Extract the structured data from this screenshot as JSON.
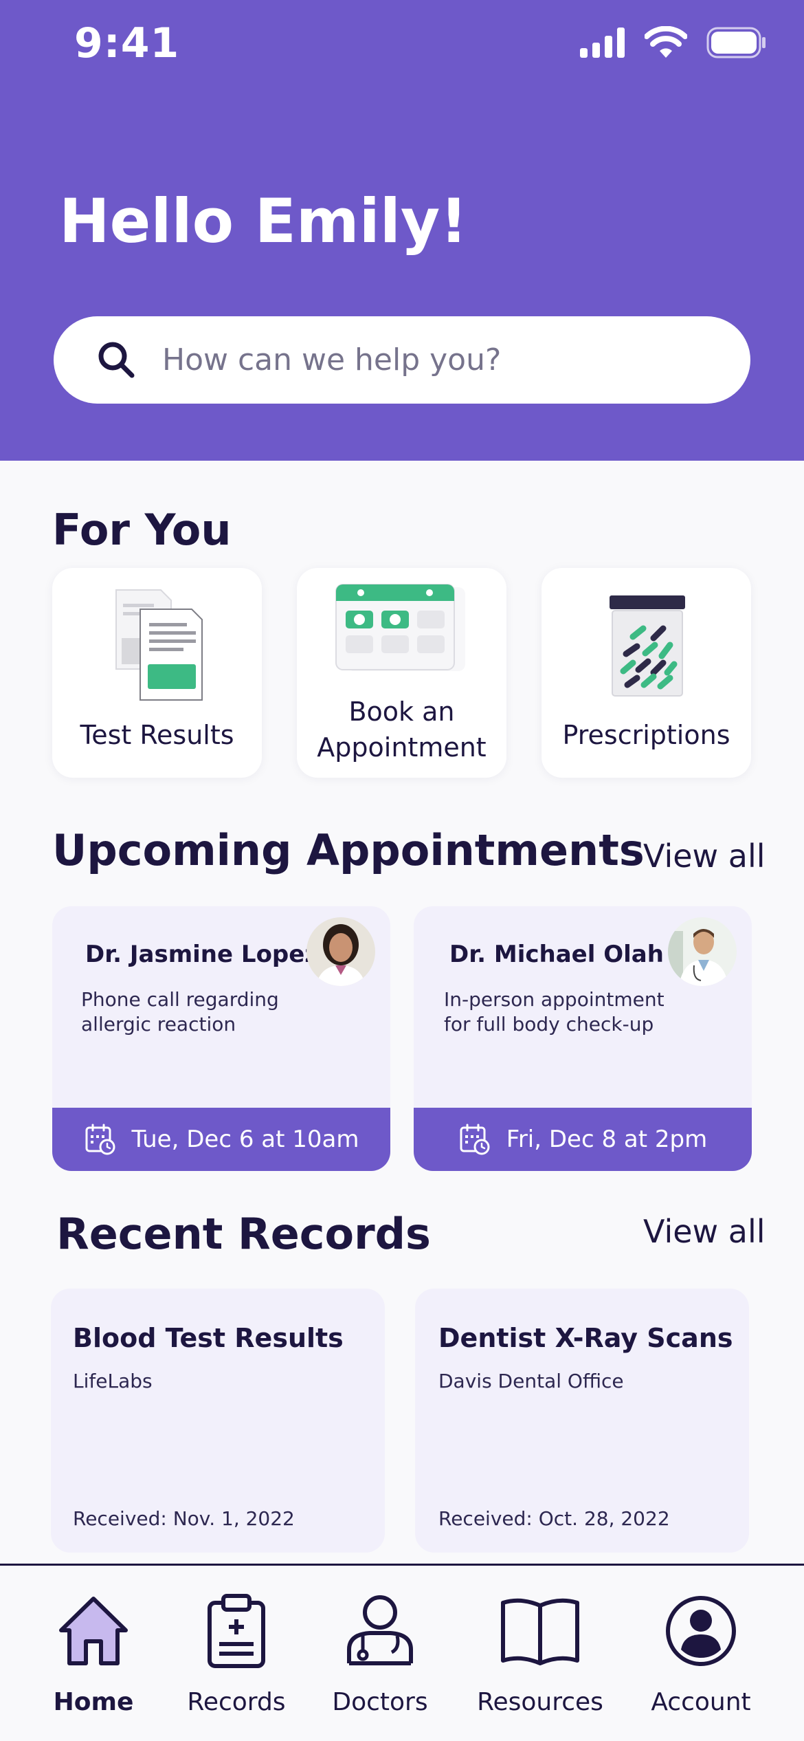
{
  "status_bar": {
    "time": "9:41"
  },
  "header": {
    "greeting": "Hello Emily!",
    "search_placeholder": "How can we help you?"
  },
  "for_you": {
    "title": "For You",
    "cards": [
      {
        "label": "Test Results",
        "icon": "documents-icon"
      },
      {
        "label": "Book an Appointment",
        "icon": "calendar-icon"
      },
      {
        "label": "Prescriptions",
        "icon": "pill-bottle-icon"
      }
    ]
  },
  "appointments": {
    "title": "Upcoming Appointments",
    "view_all": "View all",
    "items": [
      {
        "doctor": "Dr. Jasmine Lopez",
        "description": "Phone call regarding allergic reaction",
        "date": "Tue, Dec 6 at 10am"
      },
      {
        "doctor": "Dr. Michael Olah",
        "description": "In-person appointment for full body check-up",
        "date": "Fri, Dec 8 at 2pm"
      }
    ]
  },
  "records": {
    "title": "Recent Records",
    "view_all": "View all",
    "items": [
      {
        "title": "Blood Test Results",
        "source": "LifeLabs",
        "received": "Received: Nov. 1, 2022"
      },
      {
        "title": "Dentist X-Ray Scans",
        "source": "Davis Dental Office",
        "received": "Received: Oct. 28, 2022"
      }
    ]
  },
  "tabbar": {
    "active": "Home",
    "tabs": [
      {
        "label": "Home",
        "icon": "home-icon"
      },
      {
        "label": "Records",
        "icon": "clipboard-icon"
      },
      {
        "label": "Doctors",
        "icon": "doctor-icon"
      },
      {
        "label": "Resources",
        "icon": "book-icon"
      },
      {
        "label": "Account",
        "icon": "account-icon"
      }
    ]
  },
  "colors": {
    "primary": "#6e59c9",
    "dark_text": "#1d1640",
    "card_bg": "#f2f0fb",
    "accent_green": "#3dba84",
    "home_icon_fill": "#c7b9ee"
  }
}
